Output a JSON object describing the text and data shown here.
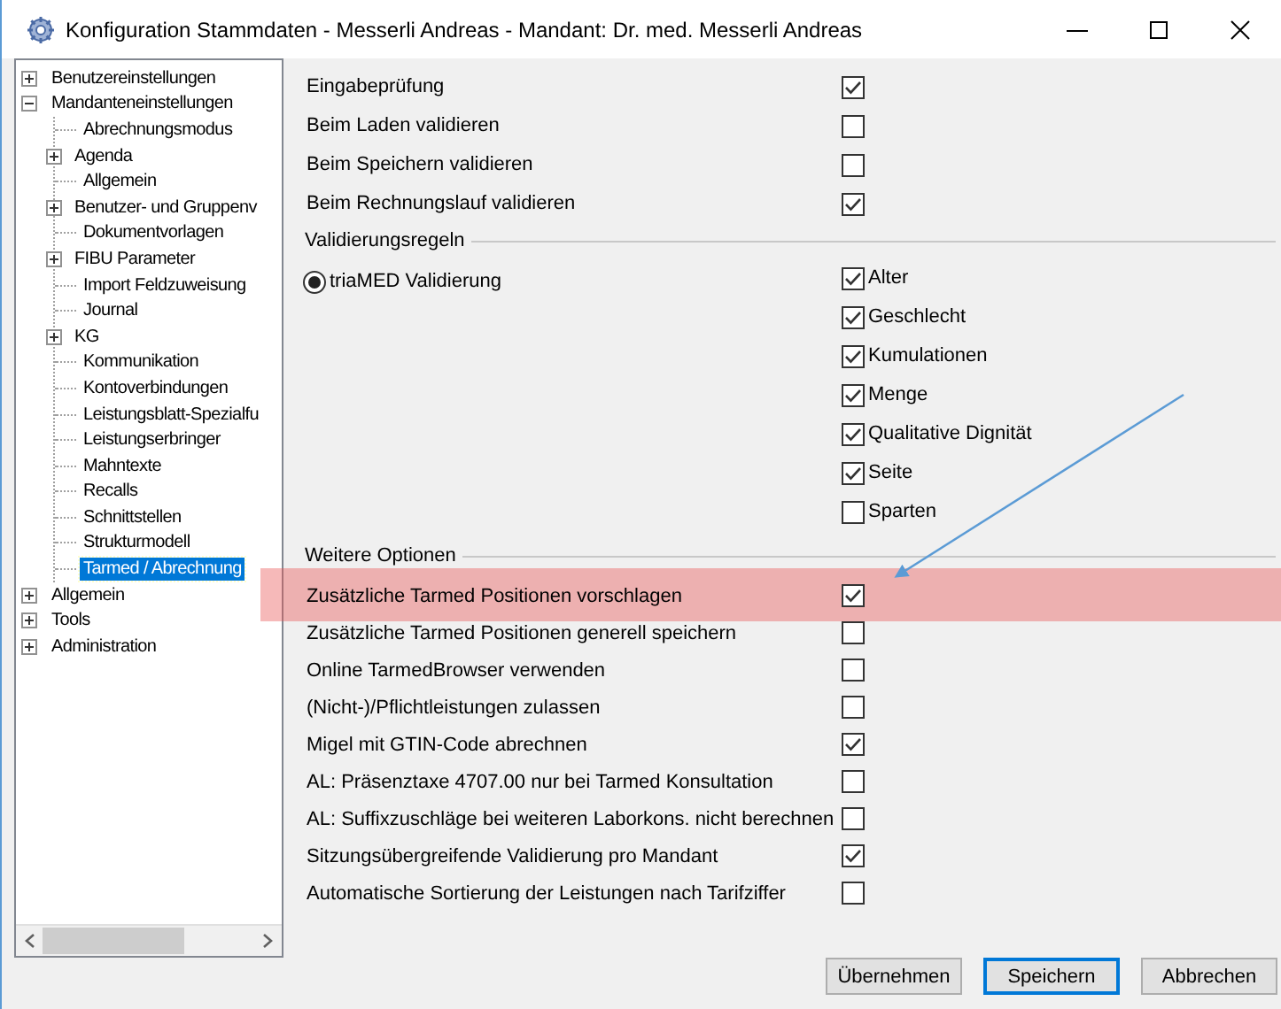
{
  "window": {
    "title": "Konfiguration Stammdaten - Messerli Andreas - Mandant: Dr. med. Messerli Andreas"
  },
  "tree": [
    {
      "label": "Benutzereinstellungen",
      "expanded": false,
      "selected": false
    },
    {
      "label": "Mandanteneinstellungen",
      "expanded": true,
      "selected": false,
      "children": [
        {
          "label": "Abrechnungsmodus",
          "selected": false
        },
        {
          "label": "Agenda",
          "expanded": false,
          "selected": false
        },
        {
          "label": "Allgemein",
          "selected": false
        },
        {
          "label": "Benutzer- und Gruppenv",
          "expanded": false,
          "selected": false
        },
        {
          "label": "Dokumentvorlagen",
          "selected": false
        },
        {
          "label": "FIBU Parameter",
          "expanded": false,
          "selected": false
        },
        {
          "label": "Import Feldzuweisung",
          "selected": false
        },
        {
          "label": "Journal",
          "selected": false
        },
        {
          "label": "KG",
          "expanded": false,
          "selected": false
        },
        {
          "label": "Kommunikation",
          "selected": false
        },
        {
          "label": "Kontoverbindungen",
          "selected": false
        },
        {
          "label": "Leistungsblatt-Spezialfu",
          "selected": false
        },
        {
          "label": "Leistungserbringer",
          "selected": false
        },
        {
          "label": "Mahntexte",
          "selected": false
        },
        {
          "label": "Recalls",
          "selected": false
        },
        {
          "label": "Schnittstellen",
          "selected": false
        },
        {
          "label": "Strukturmodell",
          "selected": false
        },
        {
          "label": "Tarmed / Abrechnung",
          "selected": true
        }
      ]
    },
    {
      "label": "Allgemein",
      "expanded": false,
      "selected": false
    },
    {
      "label": "Tools",
      "expanded": false,
      "selected": false
    },
    {
      "label": "Administration",
      "expanded": false,
      "selected": false
    }
  ],
  "general": [
    {
      "label": "Eingabeprüfung",
      "checked": true
    },
    {
      "label": "Beim Laden validieren",
      "checked": false
    },
    {
      "label": "Beim Speichern validieren",
      "checked": false
    },
    {
      "label": "Beim Rechnungslauf validieren",
      "checked": true
    }
  ],
  "validation": {
    "title": "Validierungsregeln",
    "radio": {
      "label": "triaMED Validierung",
      "selected": true
    },
    "rules": [
      {
        "label": "Alter",
        "checked": true
      },
      {
        "label": "Geschlecht",
        "checked": true
      },
      {
        "label": "Kumulationen",
        "checked": true
      },
      {
        "label": "Menge",
        "checked": true
      },
      {
        "label": "Qualitative Dignität",
        "checked": true
      },
      {
        "label": "Seite",
        "checked": true
      },
      {
        "label": "Sparten",
        "checked": false
      }
    ]
  },
  "options": {
    "title": "Weitere Optionen",
    "items": [
      {
        "label": "Zusätzliche Tarmed Positionen vorschlagen",
        "checked": true,
        "highlighted": true
      },
      {
        "label": "Zusätzliche Tarmed Positionen generell speichern",
        "checked": false,
        "highlighted": false
      },
      {
        "label": "Online TarmedBrowser verwenden",
        "checked": false,
        "highlighted": false
      },
      {
        "label": "(Nicht-)/Pflichtleistungen zulassen",
        "checked": false,
        "highlighted": false
      },
      {
        "label": "Migel mit GTIN-Code abrechnen",
        "checked": true,
        "highlighted": false
      },
      {
        "label": "AL: Präsenztaxe 4707.00 nur bei Tarmed Konsultation",
        "checked": false,
        "highlighted": false
      },
      {
        "label": "AL: Suffixzuschläge bei weiteren Laborkons. nicht berechnen",
        "checked": false,
        "highlighted": false
      },
      {
        "label": "Sitzungsübergreifende Validierung pro Mandant",
        "checked": true,
        "highlighted": false
      },
      {
        "label": "Automatische Sortierung der Leistungen nach Tarifziffer",
        "checked": false,
        "highlighted": false
      }
    ]
  },
  "buttons": [
    {
      "label": "Übernehmen",
      "default": false
    },
    {
      "label": "Speichern",
      "default": true
    },
    {
      "label": "Abbrechen",
      "default": false
    }
  ]
}
